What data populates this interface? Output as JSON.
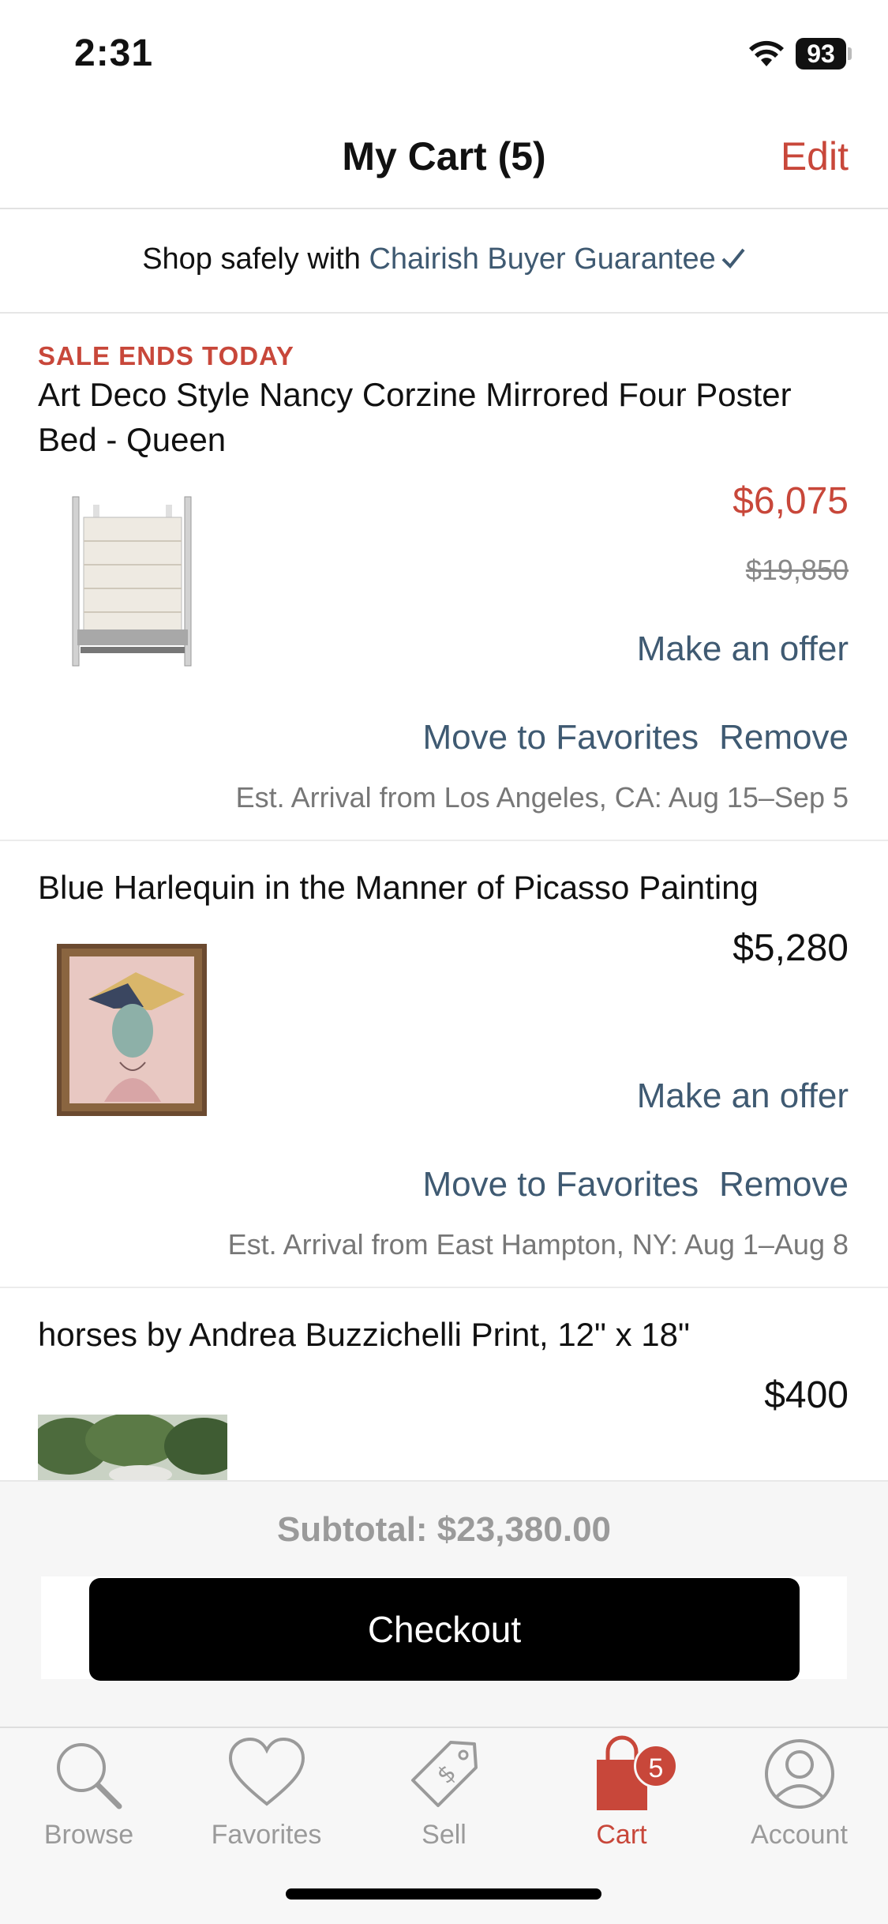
{
  "status_bar": {
    "time": "2:31",
    "battery": "93"
  },
  "header": {
    "title": "My Cart (5)",
    "edit_label": "Edit"
  },
  "guarantee": {
    "prefix": "Shop safely with ",
    "link": "Chairish Buyer Guarantee"
  },
  "items": [
    {
      "sale_tag": "SALE ENDS TODAY",
      "title": "Art Deco Style Nancy Corzine Mirrored Four Poster Bed - Queen",
      "price": "$6,075",
      "original_price": "$19,850",
      "offer_label": "Make an offer",
      "move_label": "Move to Favorites",
      "remove_label": "Remove",
      "arrival": "Est. Arrival from Los Angeles, CA: Aug 15–Sep 5"
    },
    {
      "title": "Blue Harlequin in the Manner of Picasso Painting",
      "price": "$5,280",
      "offer_label": "Make an offer",
      "move_label": "Move to Favorites",
      "remove_label": "Remove",
      "arrival": "Est. Arrival from East Hampton, NY: Aug 1–Aug 8"
    },
    {
      "title": "horses by Andrea Buzzichelli Print, 12\" x 18\"",
      "price": "$400"
    }
  ],
  "checkout": {
    "subtotal": "Subtotal: $23,380.00",
    "button_label": "Checkout"
  },
  "tabs": [
    {
      "label": "Browse",
      "icon": "search-icon"
    },
    {
      "label": "Favorites",
      "icon": "heart-icon"
    },
    {
      "label": "Sell",
      "icon": "price-tag-icon"
    },
    {
      "label": "Cart",
      "icon": "shopping-bag-icon",
      "badge": "5",
      "active": true
    },
    {
      "label": "Account",
      "icon": "user-icon"
    }
  ],
  "colors": {
    "accent": "#c8473a",
    "link": "#3f5a72",
    "muted": "#9a9a9a"
  }
}
